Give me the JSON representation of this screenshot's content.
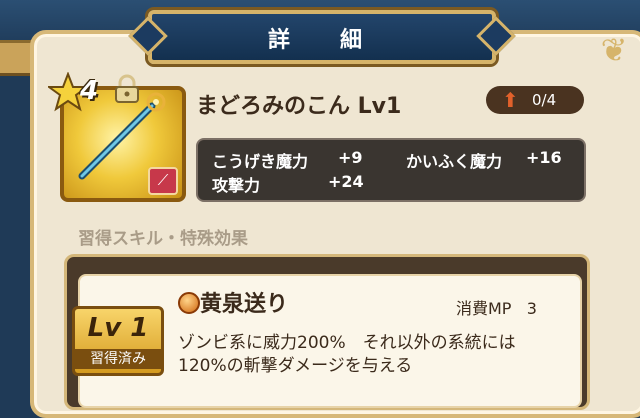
{
  "window": {
    "title": "詳　細"
  },
  "item": {
    "stars": "4",
    "name": "まどろみのこん Lv1",
    "upgrade": "0/4",
    "element_badge": "⟋"
  },
  "stats": [
    {
      "label": "こうげき魔力",
      "value": "+9"
    },
    {
      "label": "かいふく魔力",
      "value": "+16"
    },
    {
      "label": "攻撃力",
      "value": "+24"
    }
  ],
  "section": {
    "heading": "習得スキル・特殊効果"
  },
  "skill": {
    "level_label": "Lv 1",
    "acquired_label": "習得済み",
    "name": "黄泉送り",
    "mp_label": "消費MP",
    "mp_value": "3",
    "description_line1": "ゾンビ系に威力200%　それ以外の系統には",
    "description_line2": "120%の斬撃ダメージを与える"
  },
  "colors": {
    "panel": "#efe6d2",
    "gold": "#d6b46a",
    "navy": "#1f3a57",
    "dark_box": "#3a3530"
  },
  "icons": [
    "star-icon",
    "lock-icon",
    "staff-icon",
    "up-arrow-icon",
    "skill-orb-icon",
    "fleur-ornament-icon"
  ]
}
